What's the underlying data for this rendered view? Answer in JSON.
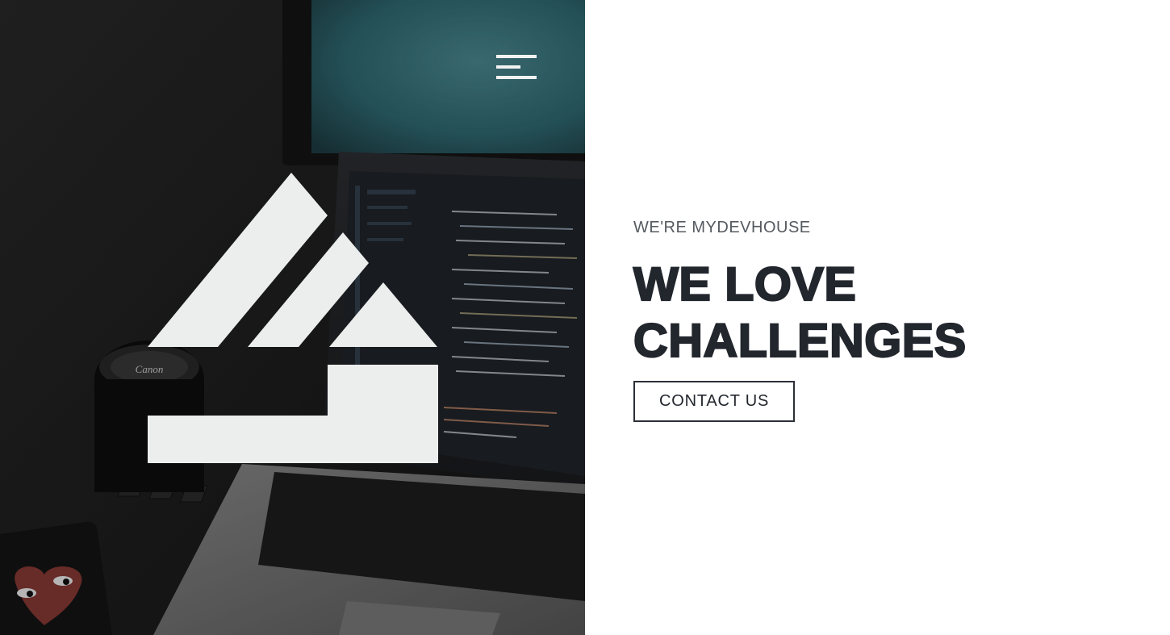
{
  "hero": {
    "lens_text": "Canon",
    "logo": "mydevhouse-logo-mark"
  },
  "menu": {
    "icon": "hamburger-menu-icon"
  },
  "content": {
    "eyebrow": "WE'RE MYDEVHOUSE",
    "headline_line1": "WE LOVE",
    "headline_line2": "CHALLENGES",
    "cta_label": "CONTACT US"
  },
  "colors": {
    "text_dark": "#22262d",
    "logo_fill": "#eceeed",
    "background": "#ffffff"
  }
}
